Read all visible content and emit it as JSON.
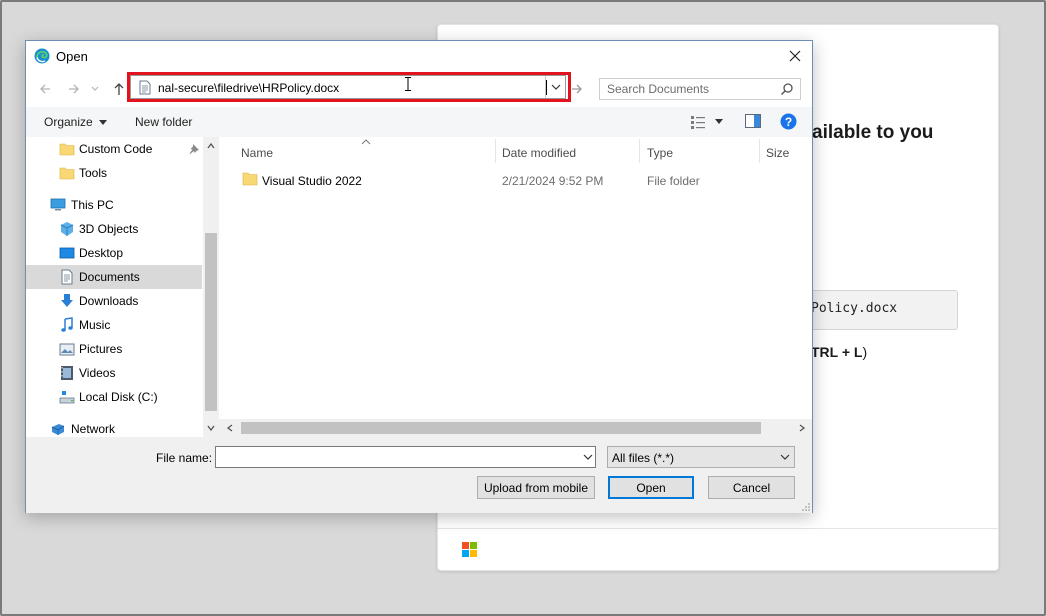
{
  "dialog": {
    "title": "Open",
    "address": {
      "path": "nal-secure\\filedrive\\HRPolicy.docx"
    },
    "search": {
      "placeholder": "Search Documents"
    },
    "toolbar": {
      "organize_label": "Organize",
      "new_folder_label": "New folder"
    },
    "nav": {
      "items": [
        {
          "label": "Custom Code",
          "icon": "folder-icon",
          "pinned": true
        },
        {
          "label": "Tools",
          "icon": "folder-icon"
        },
        {
          "label": "This PC",
          "icon": "pc-icon"
        },
        {
          "label": "3D Objects",
          "icon": "3d-objects-icon"
        },
        {
          "label": "Desktop",
          "icon": "desktop-icon"
        },
        {
          "label": "Documents",
          "icon": "documents-icon",
          "selected": true
        },
        {
          "label": "Downloads",
          "icon": "downloads-icon"
        },
        {
          "label": "Music",
          "icon": "music-icon"
        },
        {
          "label": "Pictures",
          "icon": "pictures-icon"
        },
        {
          "label": "Videos",
          "icon": "videos-icon"
        },
        {
          "label": "Local Disk (C:)",
          "icon": "drive-icon"
        },
        {
          "label": "Network",
          "icon": "network-icon"
        }
      ]
    },
    "files": {
      "columns": [
        "Name",
        "Date modified",
        "Type",
        "Size"
      ],
      "rows": [
        {
          "name": "Visual Studio 2022",
          "date_modified": "2/21/2024 9:52 PM",
          "type": "File folder",
          "size": ""
        }
      ]
    },
    "bottom": {
      "file_name_label": "File name:",
      "file_name_value": "",
      "filter_value": "All files (*.*)",
      "upload_label": "Upload from mobile",
      "open_label": "Open",
      "cancel_label": "Cancel"
    }
  },
  "background_page": {
    "heading_fragment": "ailable to you",
    "code_fragment": "Policy.docx",
    "shortcut_fragment_bold": "TRL + L",
    "shortcut_fragment_close": ")"
  },
  "colors": {
    "highlight": "#e0141e",
    "primary_button_border": "#0078d7",
    "help_icon": "#1a73e8"
  }
}
